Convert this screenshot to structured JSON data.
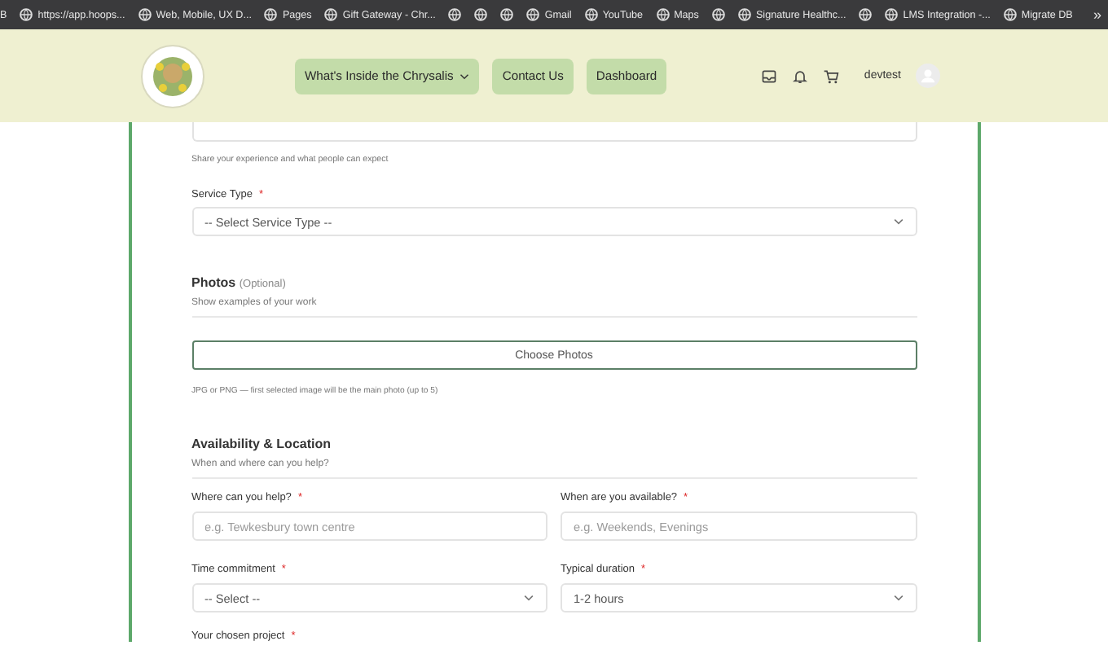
{
  "bookmarks_cut": "B",
  "bookmarks": [
    {
      "kind": "labeled",
      "label": "https://app.hoops..."
    },
    {
      "kind": "labeled",
      "label": "Web, Mobile, UX D..."
    },
    {
      "kind": "labeled",
      "label": "Pages"
    },
    {
      "kind": "labeled",
      "label": "Gift Gateway - Chr..."
    },
    {
      "kind": "icon"
    },
    {
      "kind": "icon"
    },
    {
      "kind": "icon"
    },
    {
      "kind": "labeled",
      "label": "Gmail"
    },
    {
      "kind": "labeled",
      "label": "YouTube"
    },
    {
      "kind": "labeled",
      "label": "Maps"
    },
    {
      "kind": "icon"
    },
    {
      "kind": "labeled",
      "label": "Signature Healthc..."
    },
    {
      "kind": "icon"
    },
    {
      "kind": "labeled",
      "label": "LMS Integration -..."
    },
    {
      "kind": "labeled",
      "label": "Migrate DB"
    }
  ],
  "bookmarks_more": "»",
  "nav": [
    {
      "label": "What's Inside the Chrysalis",
      "dropdown": true
    },
    {
      "label": "Contact Us",
      "dropdown": false
    },
    {
      "label": "Dashboard",
      "dropdown": false
    }
  ],
  "user": {
    "name": "devtest"
  },
  "form": {
    "description_hint": "Share your experience and what people can expect",
    "service_type": {
      "label": "Service Type",
      "mark": "*",
      "kind": "select",
      "value": "-- Select Service Type --"
    },
    "photos": {
      "title": "Photos",
      "optional": "(Optional)",
      "subtitle": "Show examples of your work",
      "button": "Choose Photos",
      "note": "JPG or PNG — first selected image will be the main photo (up to 5)"
    },
    "availability": {
      "title": "Availability & Location",
      "subtitle": "When and where can you help?",
      "fields": [
        {
          "label": "Where can you help?",
          "mark": "*",
          "kind": "input",
          "placeholder": "e.g. Tewkesbury town centre"
        },
        {
          "label": "When are you available?",
          "mark": "*",
          "kind": "input",
          "placeholder": "e.g. Weekends, Evenings"
        },
        {
          "label": "Time commitment",
          "mark": "*",
          "kind": "select",
          "value": "-- Select --"
        },
        {
          "label": "Typical duration",
          "mark": "*",
          "kind": "select",
          "value": "1-2 hours"
        }
      ]
    },
    "project": {
      "label": "Your chosen project",
      "mark": "*"
    }
  }
}
